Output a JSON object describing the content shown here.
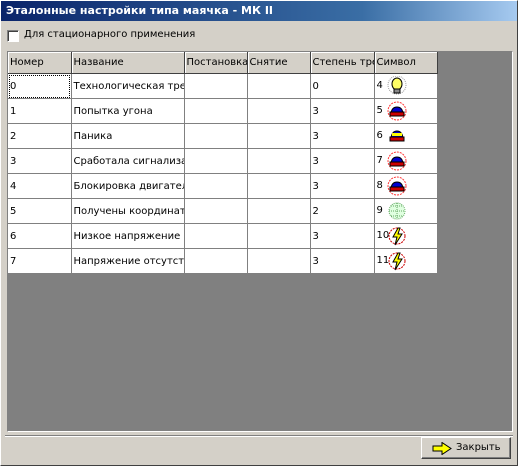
{
  "window": {
    "title": "Эталонные настройки типа маячка - МК II"
  },
  "stationary": {
    "label": "Для стационарного применения",
    "checked": false
  },
  "grid": {
    "columns": [
      "Номер",
      "Название",
      "Постановка",
      "Снятие",
      "Степень тре",
      "Символ"
    ],
    "rows": [
      {
        "number": "0",
        "name": "Технологическая трев",
        "arm": "",
        "disarm": "",
        "level": "0",
        "symbol": "4",
        "icon": "lightbulb-icon"
      },
      {
        "number": "1",
        "name": "Попытка угона",
        "arm": "",
        "disarm": "",
        "level": "3",
        "symbol": "5",
        "icon": "car-alarm-icon"
      },
      {
        "number": "2",
        "name": "Паника",
        "arm": "",
        "disarm": "",
        "level": "3",
        "symbol": "6",
        "icon": "car-icon"
      },
      {
        "number": "3",
        "name": "Сработала сигнализац",
        "arm": "",
        "disarm": "",
        "level": "3",
        "symbol": "7",
        "icon": "car-alarm-icon"
      },
      {
        "number": "4",
        "name": "Блокировка двигателя",
        "arm": "",
        "disarm": "",
        "level": "3",
        "symbol": "8",
        "icon": "car-alarm-icon"
      },
      {
        "number": "5",
        "name": "Получены координаты",
        "arm": "",
        "disarm": "",
        "level": "2",
        "symbol": "9",
        "icon": "globe-icon"
      },
      {
        "number": "6",
        "name": "Низкое напряжение",
        "arm": "",
        "disarm": "",
        "level": "3",
        "symbol": "10",
        "icon": "lightning-icon"
      },
      {
        "number": "7",
        "name": "Напряжение отсутству",
        "arm": "",
        "disarm": "",
        "level": "3",
        "symbol": "11",
        "icon": "lightning-icon"
      }
    ]
  },
  "buttons": {
    "close": "Закрыть"
  }
}
